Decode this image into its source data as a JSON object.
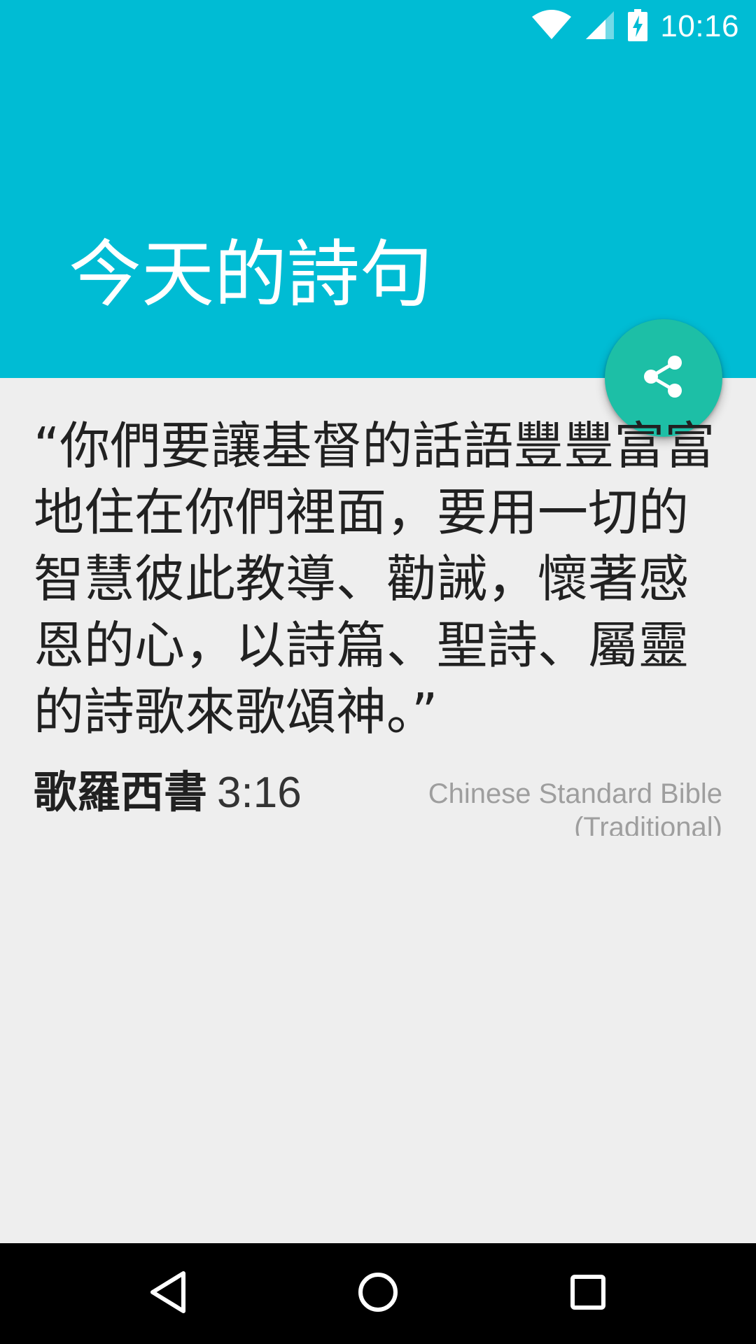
{
  "status_bar": {
    "time": "10:16",
    "icons": [
      "wifi-icon",
      "signal-icon",
      "battery-charging-icon"
    ]
  },
  "header": {
    "title": "今天的詩句",
    "background_color": "#00bcd4"
  },
  "fab": {
    "icon": "share-icon",
    "color": "#1dbfa6"
  },
  "verse": {
    "text": "“你們要讓基督的話語豐豐富富地住在你們裡面，要用一切的智慧彼此教導、勸誡，懷著感恩的心，以詩篇、聖詩、屬靈的詩歌來歌頌神。”",
    "book": "歌羅西書",
    "chapter_verse": "3:16",
    "translation": "Chinese Standard Bible (Traditional)"
  },
  "nav_bar": {
    "buttons": [
      "back-icon",
      "home-icon",
      "recents-icon"
    ]
  }
}
